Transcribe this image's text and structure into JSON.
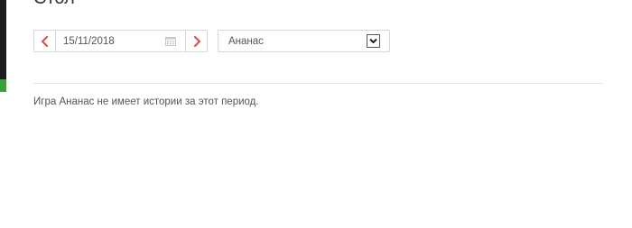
{
  "page": {
    "title": "Стол"
  },
  "filters": {
    "date_value": "15/11/2018",
    "prev_icon": "chevron-left-icon",
    "next_icon": "chevron-right-icon",
    "calendar_icon": "calendar-icon",
    "game_select_value": "Ананас",
    "dropdown_icon": "chevron-down-icon"
  },
  "content": {
    "empty_message": "Игра Ананас не имеет истории за этот период."
  },
  "colors": {
    "accent_red": "#d9534f",
    "text": "#555555",
    "border": "#d6d6d6",
    "divider": "#e3e3e3"
  }
}
